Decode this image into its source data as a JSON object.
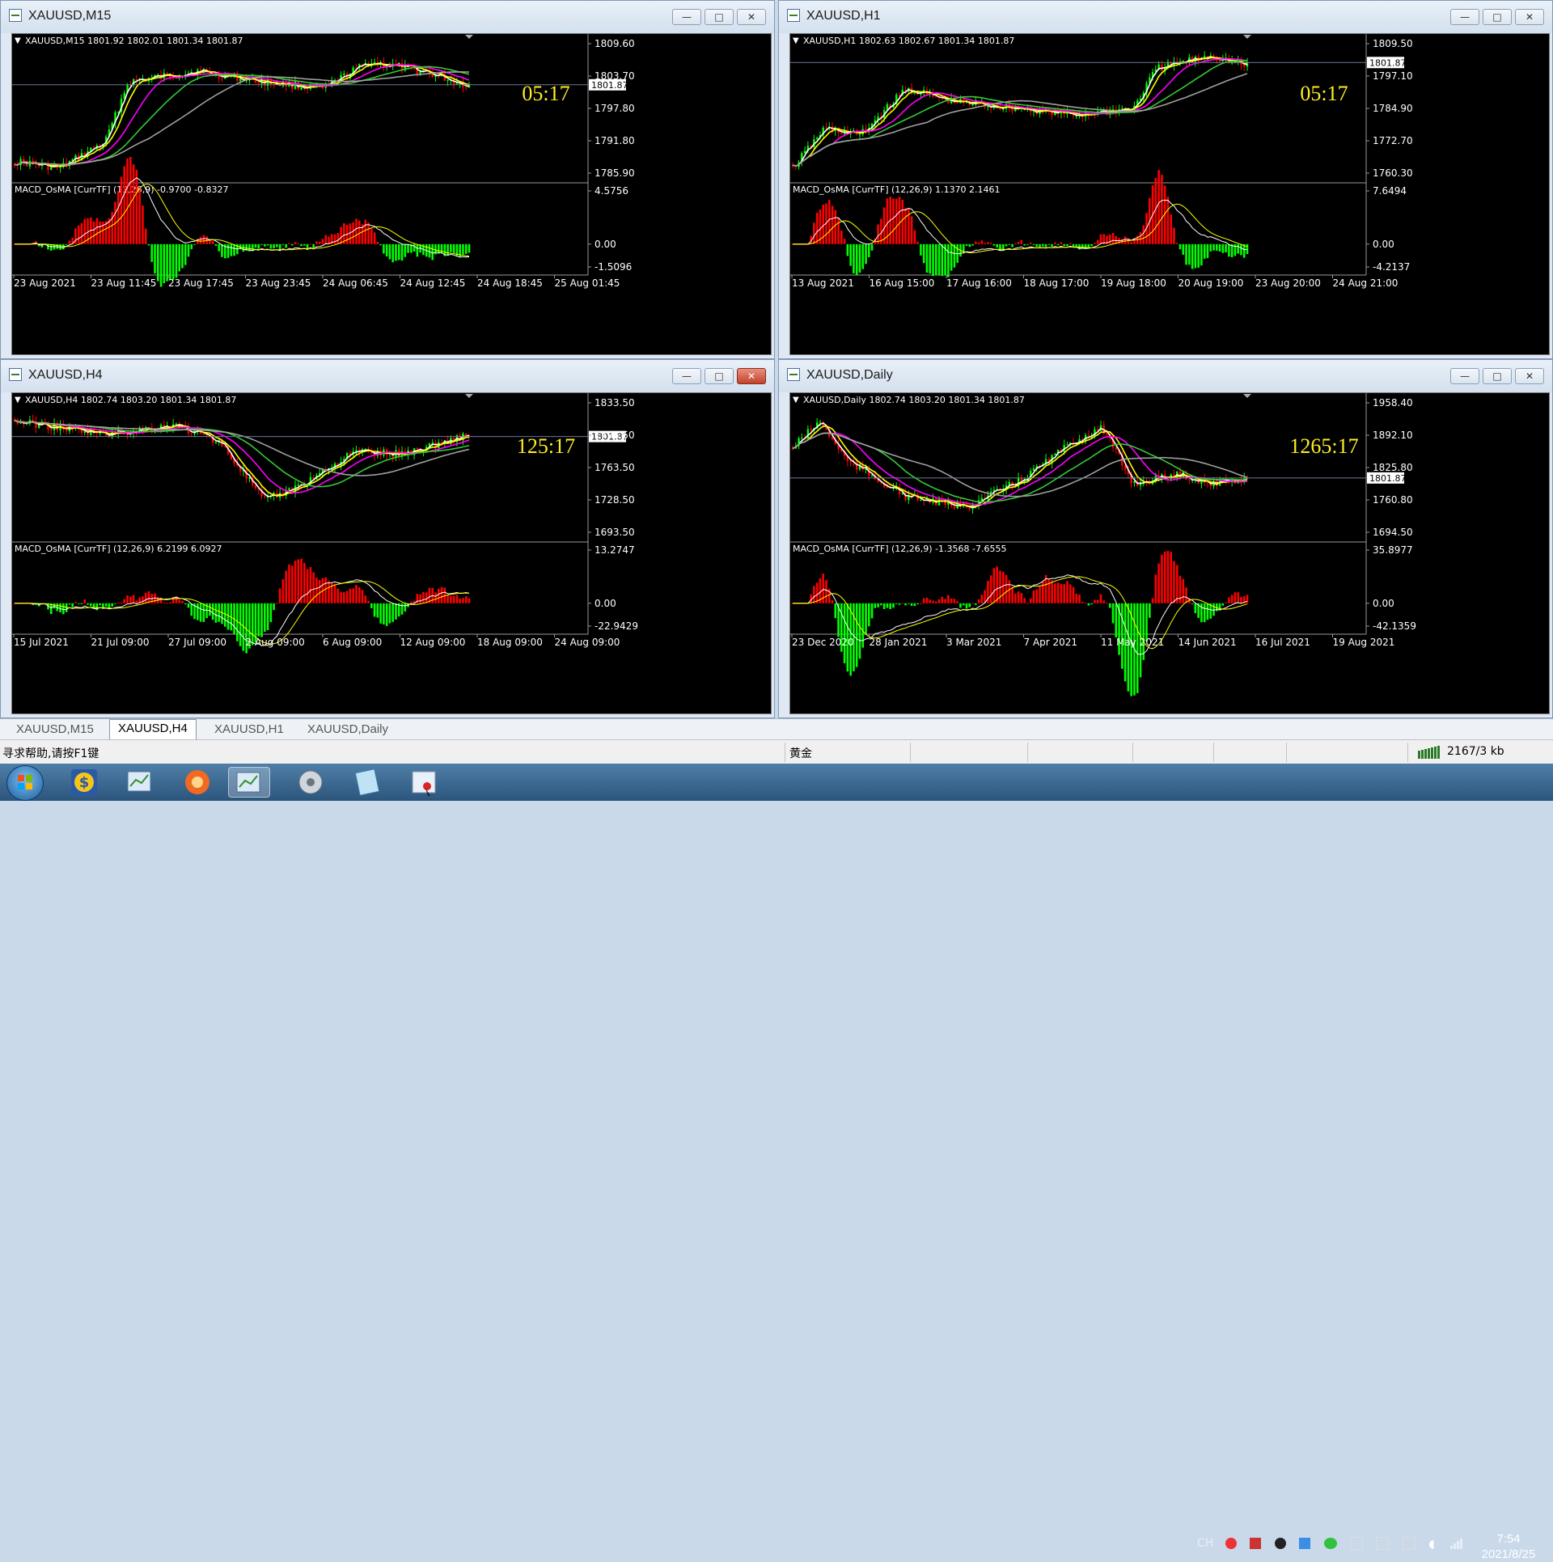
{
  "windows": [
    {
      "key": "m15",
      "title": "XAUUSD,M15",
      "quote": "XAUUSD,M15  1801.92 1802.01 1801.34 1801.87",
      "countdown": "05:17",
      "price_ticks": [
        "1809.60",
        "1803.70",
        "1797.80",
        "1791.80",
        "1785.90"
      ],
      "current_price": "1801.87",
      "indicator": "MACD_OsMA [CurrTF] (12,26,9) -0.9700 -0.8327",
      "ind_ticks": [
        "4.5756",
        "0.00",
        "-1.5096"
      ],
      "time_labels": [
        "23 Aug 2021",
        "23 Aug 11:45",
        "23 Aug 17:45",
        "23 Aug 23:45",
        "24 Aug 06:45",
        "24 Aug 12:45",
        "24 Aug 18:45",
        "25 Aug 01:45"
      ],
      "close_active": false
    },
    {
      "key": "h1",
      "title": "XAUUSD,H1",
      "quote": "XAUUSD,H1  1802.63 1802.67 1801.34 1801.87",
      "countdown": "05:17",
      "price_ticks": [
        "1809.50",
        "1797.10",
        "1784.90",
        "1772.70",
        "1760.30"
      ],
      "current_price": "1801.87",
      "indicator": "MACD_OsMA [CurrTF] (12,26,9) 1.1370 2.1461",
      "ind_ticks": [
        "7.6494",
        "0.00",
        "-4.2137"
      ],
      "time_labels": [
        "13 Aug 2021",
        "16 Aug 15:00",
        "17 Aug 16:00",
        "18 Aug 17:00",
        "19 Aug 18:00",
        "20 Aug 19:00",
        "23 Aug 20:00",
        "24 Aug 21:00"
      ],
      "close_active": false
    },
    {
      "key": "h4",
      "title": "XAUUSD,H4",
      "quote": "XAUUSD,H4  1802.74 1803.20 1801.34 1801.87",
      "countdown": "125:17",
      "price_ticks": [
        "1833.50",
        "1798.50",
        "1763.50",
        "1728.50",
        "1693.50"
      ],
      "current_price": "1801.87",
      "indicator": "MACD_OsMA [CurrTF] (12,26,9) 6.2199 6.0927",
      "ind_ticks": [
        "13.2747",
        "0.00",
        "-22.9429"
      ],
      "time_labels": [
        "15 Jul 2021",
        "21 Jul 09:00",
        "27 Jul 09:00",
        "2 Aug 09:00",
        "6 Aug 09:00",
        "12 Aug 09:00",
        "18 Aug 09:00",
        "24 Aug 09:00"
      ],
      "close_active": true
    },
    {
      "key": "daily",
      "title": "XAUUSD,Daily",
      "quote": "XAUUSD,Daily  1802.74 1803.20 1801.34 1801.87",
      "countdown": "1265:17",
      "price_ticks": [
        "1958.40",
        "1892.10",
        "1825.80",
        "1760.80",
        "1694.50"
      ],
      "current_price": "1801.87",
      "indicator": "MACD_OsMA [CurrTF] (12,26,9) -1.3568 -7.6555",
      "ind_ticks": [
        "35.8977",
        "0.00",
        "-42.1359"
      ],
      "time_labels": [
        "23 Dec 2020",
        "28 Jan 2021",
        "3 Mar 2021",
        "7 Apr 2021",
        "11 May 2021",
        "14 Jun 2021",
        "16 Jul 2021",
        "19 Aug 2021"
      ],
      "close_active": false
    }
  ],
  "window_buttons": {
    "minimize": "—",
    "maximize": "□",
    "close": "✕"
  },
  "tabs": [
    "XAUUSD,M15",
    "XAUUSD,H4",
    "XAUUSD,H1",
    "XAUUSD,Daily"
  ],
  "active_tab": "XAUUSD,H4",
  "status": {
    "help": "寻求帮助,请按F1键",
    "profile": "黄金",
    "connection": "2167/3 kb"
  },
  "taskbar": {
    "lang": "CH",
    "time": "7:54",
    "date": "2021/8/25"
  },
  "colors": {
    "ma_white": "#ffffff",
    "ma_yellow": "#ffff00",
    "ma_magenta": "#ff00ff",
    "ma_green": "#33cc33",
    "ma_gray": "#a0a0a0",
    "bull": "#00ff00",
    "bear": "#ff0000",
    "countdown": "#ffee22"
  }
}
